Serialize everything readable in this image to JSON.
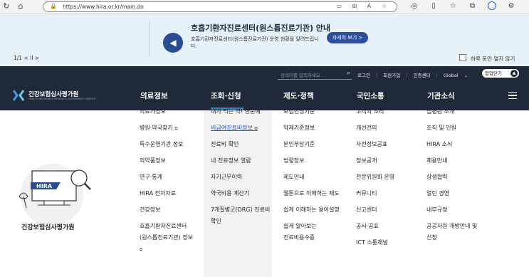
{
  "browser": {
    "url": "https://www.hira.or.kr/main.do"
  },
  "popup": {
    "title": "호흡기환자진료센터(원스톱진료기관) 안내",
    "description": "호흡기환자진료센터(원스톱진료기관) 운영 현황을 알려드립니다.",
    "detail_button": "자세히 보기 >",
    "counter": "1/1  <  II  >",
    "hide_today_label": "하루 동안 열지 않기"
  },
  "utility": {
    "search_placeholder": "검색어를 입력하세요",
    "login": "로그인",
    "join": "회원가입",
    "cert_center": "인증센터",
    "global": "Global",
    "popup_close": "팝업닫기"
  },
  "logo": {
    "name": "건강보험심사평가원",
    "sub": "HEALTH INSURANCE REVIEW & ASSESSMENT SERVICE"
  },
  "gnb": {
    "items": [
      "의료정보",
      "조회·신청",
      "제도·정책",
      "국민소통",
      "기관소식"
    ]
  },
  "illustration": {
    "badge": "HIRA",
    "caption": "건강보험심사평가원"
  },
  "menu": {
    "col1": [
      "의료가정보",
      "병원·약국찾기",
      "특수운영기관 정보",
      "의약품정보",
      "연구·통계",
      "HIRA 전자자료",
      "건강정보",
      "호흡기환자진료센터",
      "(원스톱진료기관) 정보"
    ],
    "col2": [
      "내가 먹는 약! 한눈에",
      "비급여진료비정보",
      "진료비 확인",
      "내 진료정보 열람",
      "자기근무이력",
      "약국비용 계산기",
      "7개질병군(DRG) 진료비",
      "확인"
    ],
    "col3": [
      "보험인정기준",
      "약제기준정보",
      "본인부담기준",
      "법령정보",
      "제도안내",
      "웹툰으로 이해하는 제도",
      "쉽게 이해하는 용어설명",
      "쉽게 알아보는",
      "진료비용수증"
    ],
    "col4": [
      "고객의 소리",
      "개선건의",
      "사전정보공표",
      "정보공개",
      "전문위원회 운영",
      "커뮤니티",
      "신고센터",
      "공시·공표",
      "ICT 소통채널"
    ],
    "col5": [
      "심평원 소개",
      "조직 및 인원",
      "HIRA 소식",
      "채용안내",
      "상생협력",
      "열린 경영",
      "내부규정",
      "공공자원 개방안내 및",
      "신청"
    ]
  }
}
